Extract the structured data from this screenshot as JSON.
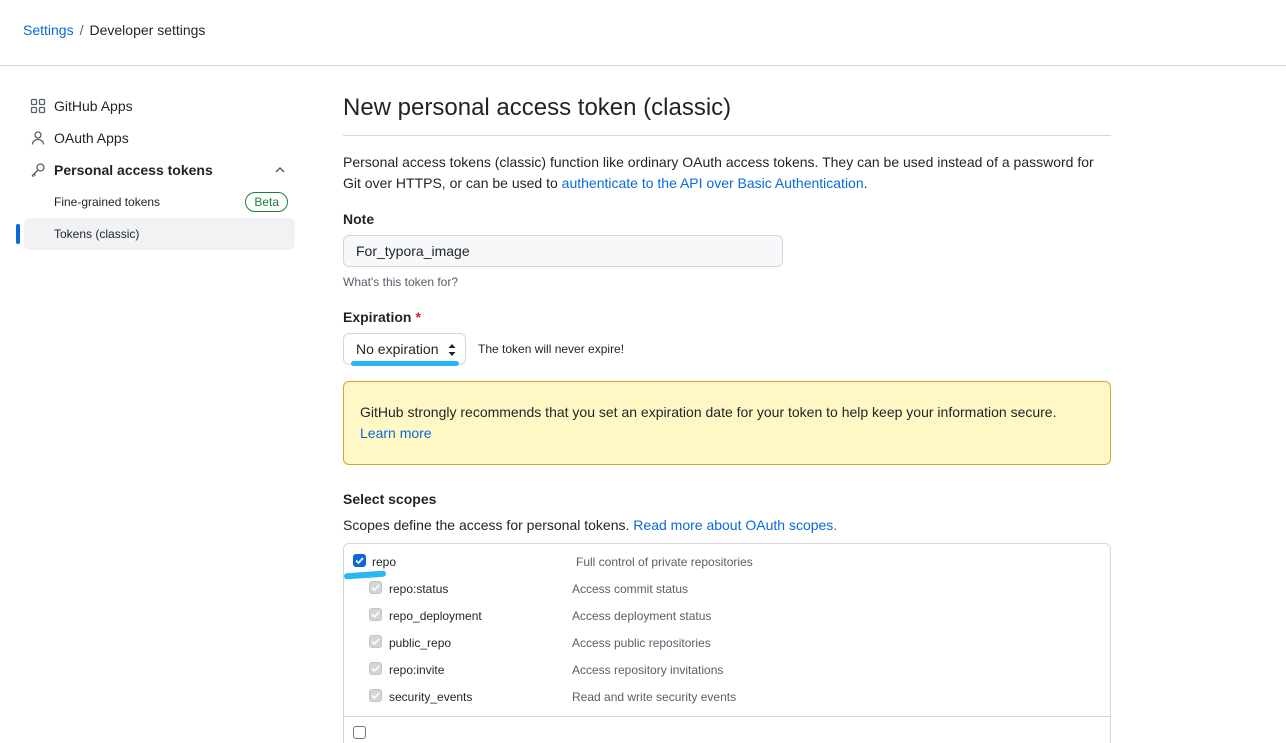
{
  "breadcrumb": {
    "root": "Settings",
    "separator": "/",
    "current": "Developer settings"
  },
  "sidebar": {
    "items": [
      {
        "label": "GitHub Apps",
        "icon": "apps-grid-icon"
      },
      {
        "label": "OAuth Apps",
        "icon": "person-icon"
      },
      {
        "label": "Personal access tokens",
        "icon": "key-icon",
        "expanded": true
      }
    ],
    "subitems": [
      {
        "label": "Fine-grained tokens",
        "badge": "Beta"
      },
      {
        "label": "Tokens (classic)",
        "active": true
      }
    ]
  },
  "main": {
    "title": "New personal access token (classic)",
    "intro_text": "Personal access tokens (classic) function like ordinary OAuth access tokens. They can be used instead of a password for Git over HTTPS, or can be used to",
    "intro_link": "authenticate to the API over Basic Authentication",
    "intro_end": ".",
    "note": {
      "label": "Note",
      "value": "For_typora_image",
      "hint": "What's this token for?"
    },
    "expiration": {
      "label": "Expiration",
      "required": "*",
      "selected": "No expiration",
      "hint": "The token will never expire!"
    },
    "warning": {
      "text": "GitHub strongly recommends that you set an expiration date for your token to help keep your information secure.",
      "link": "Learn more"
    },
    "scopes": {
      "label": "Select scopes",
      "desc": "Scopes define the access for personal tokens.",
      "desc_link": "Read more about OAuth scopes.",
      "items": [
        {
          "name": "repo",
          "desc": "Full control of private repositories",
          "checked": true,
          "parent": true
        },
        {
          "name": "repo:status",
          "desc": "Access commit status",
          "checked": true
        },
        {
          "name": "repo_deployment",
          "desc": "Access deployment status",
          "checked": true
        },
        {
          "name": "public_repo",
          "desc": "Access public repositories",
          "checked": true
        },
        {
          "name": "repo:invite",
          "desc": "Access repository invitations",
          "checked": true
        },
        {
          "name": "security_events",
          "desc": "Read and write security events",
          "checked": true
        }
      ]
    }
  },
  "colors": {
    "accent": "#0969da",
    "warning_bg": "#fff8c5",
    "warning_border": "#d4a72c",
    "annotation": "#29b6f6",
    "beta": "#1a7f37"
  }
}
